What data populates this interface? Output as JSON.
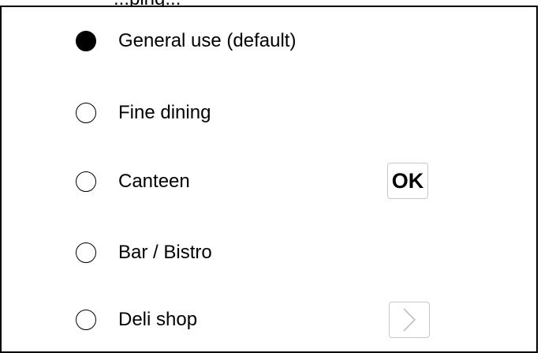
{
  "header": {
    "partial_text": "...ping..."
  },
  "options": [
    {
      "label": "General use (default)",
      "selected": true
    },
    {
      "label": "Fine dining",
      "selected": false
    },
    {
      "label": "Canteen",
      "selected": false
    },
    {
      "label": "Bar / Bistro",
      "selected": false
    },
    {
      "label": "Deli shop",
      "selected": false
    }
  ],
  "buttons": {
    "ok_label": "OK",
    "next_icon": "chevron-right-icon"
  },
  "colors": {
    "foreground": "#000000",
    "background": "#ffffff",
    "button_border": "#c8c8c8",
    "chevron": "#c0c0c0"
  }
}
